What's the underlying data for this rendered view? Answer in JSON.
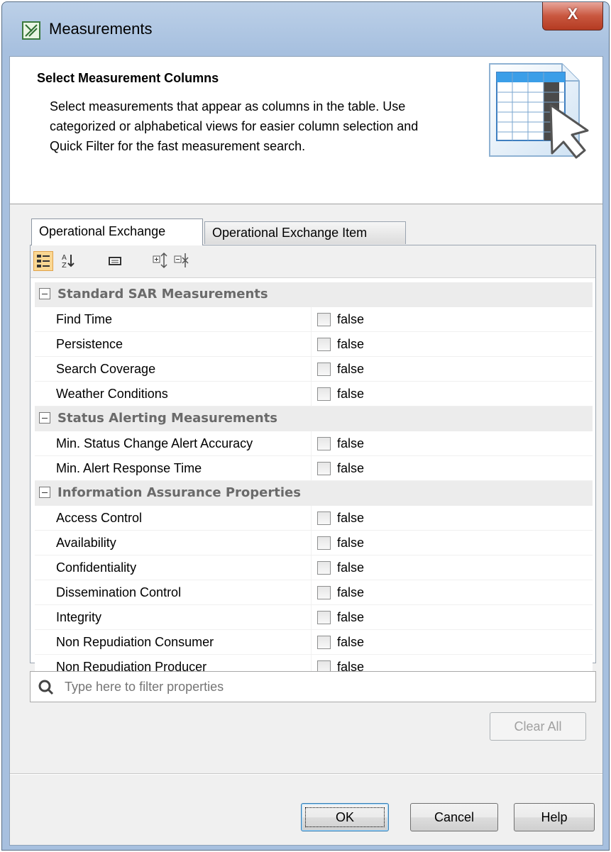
{
  "window": {
    "title": "Measurements",
    "close_glyph": "X"
  },
  "header": {
    "title": "Select Measurement Columns",
    "description": "Select measurements that appear as columns in the table. Use categorized or alphabetical views for easier column selection and Quick Filter for the fast measurement search.",
    "icon": "table-column-select-icon"
  },
  "tabs": [
    {
      "label": "Operational Exchange",
      "active": true
    },
    {
      "label": "Operational Exchange Item",
      "active": false
    }
  ],
  "toolbar": {
    "icons": [
      "categorized-view-icon",
      "alphabetical-sort-icon",
      "description-icon",
      "expand-all-icon",
      "collapse-all-icon"
    ],
    "selected": "categorized-view-icon"
  },
  "grid": {
    "categories": [
      {
        "label": "Standard SAR Measurements",
        "properties": [
          {
            "name": "Find Time",
            "value": "false"
          },
          {
            "name": "Persistence",
            "value": "false"
          },
          {
            "name": "Search Coverage",
            "value": "false"
          },
          {
            "name": "Weather Conditions",
            "value": "false"
          }
        ]
      },
      {
        "label": "Status Alerting Measurements",
        "properties": [
          {
            "name": "Min. Status Change Alert Accuracy",
            "value": "false"
          },
          {
            "name": "Min. Alert Response Time",
            "value": "false"
          }
        ]
      },
      {
        "label": "Information Assurance Properties",
        "properties": [
          {
            "name": "Access Control",
            "value": "false"
          },
          {
            "name": "Availability",
            "value": "false"
          },
          {
            "name": "Confidentiality",
            "value": "false"
          },
          {
            "name": "Dissemination Control",
            "value": "false"
          },
          {
            "name": "Integrity",
            "value": "false"
          },
          {
            "name": "Non Repudiation Consumer",
            "value": "false"
          },
          {
            "name": "Non Repudiation Producer",
            "value": "false"
          }
        ]
      }
    ]
  },
  "filter": {
    "placeholder": "Type here to filter properties"
  },
  "buttons": {
    "clear_all": "Clear All",
    "ok": "OK",
    "cancel": "Cancel",
    "help": "Help"
  }
}
